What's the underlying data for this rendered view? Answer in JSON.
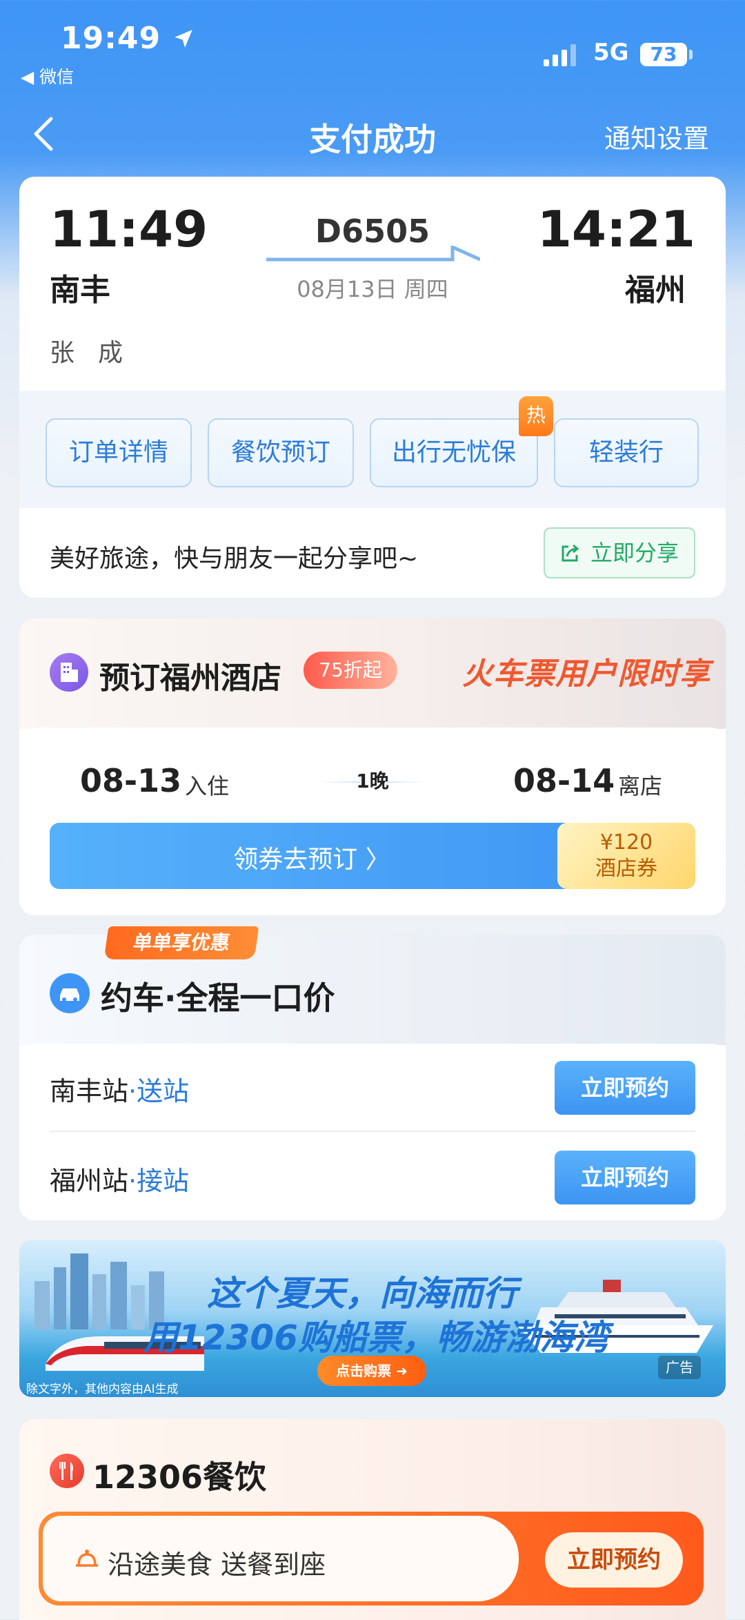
{
  "status_bar": {
    "time": "19:49",
    "back_app": "◀ 微信",
    "network": "5G",
    "battery": "73"
  },
  "nav": {
    "title": "支付成功",
    "right_action": "通知设置"
  },
  "ticket": {
    "departure_time": "11:49",
    "departure_station": "南丰",
    "arrival_time": "14:21",
    "arrival_station": "福州",
    "train_no": "D6505",
    "date": "08月13日 周四",
    "passenger": "张成"
  },
  "actions": {
    "order_detail": "订单详情",
    "catering_booking": "餐饮预订",
    "travel_insurance": "出行无忧保",
    "hot_badge": "热",
    "light_travel": "轻装行"
  },
  "share": {
    "text": "美好旅途，快与朋友一起分享吧~",
    "button": "立即分享"
  },
  "hotel": {
    "title": "预订福州酒店",
    "discount": "75折起",
    "slogan": "火车票用户限时享",
    "checkin_date": "08-13",
    "checkin_label": "入住",
    "nights": "1晚",
    "checkout_date": "08-14",
    "checkout_label": "离店",
    "coupon_button": "领券去预订 〉",
    "coupon_amount": "¥120",
    "coupon_type": "酒店券"
  },
  "car": {
    "promo_tag": "单单享优惠",
    "title": "约车·全程一口价",
    "rows": [
      {
        "station": "南丰站",
        "service": "·送站",
        "button": "立即预约"
      },
      {
        "station": "福州站",
        "service": "·接站",
        "button": "立即预约"
      }
    ]
  },
  "banner": {
    "line1": "这个夏天，向海而行",
    "line2": "用12306购船票，畅游渤海湾",
    "button": "点击购票 ➜",
    "note": "除文字外，其他内容由AI生成",
    "ad_label": "广告"
  },
  "catering": {
    "title": "12306餐饮",
    "text": "沿途美食  送餐到座",
    "button": "立即预约"
  },
  "colors": {
    "primary_blue": "#3f95f5",
    "link_blue": "#2b7cd9",
    "orange": "#ff6a1f",
    "green": "#22aa66"
  },
  "icons": [
    "back-arrow-icon",
    "location-arrow-icon",
    "signal-icon",
    "hotel-icon",
    "car-icon",
    "share-icon",
    "catering-icon",
    "bell-icon"
  ]
}
